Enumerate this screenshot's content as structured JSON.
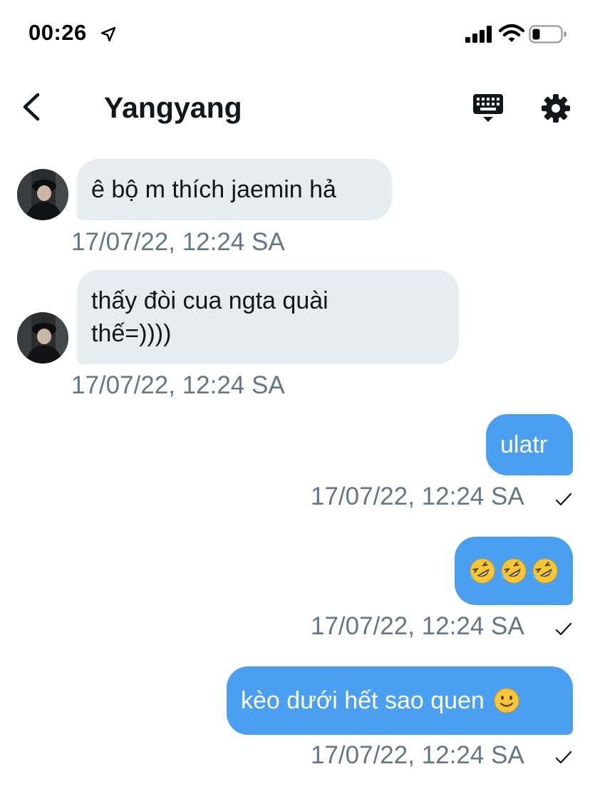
{
  "status_bar": {
    "time": "00:26"
  },
  "header": {
    "title": "Yangyang"
  },
  "messages": [
    {
      "direction": "in",
      "text": "ê bộ m thích jaemin hả",
      "timestamp": "17/07/22, 12:24 SA"
    },
    {
      "direction": "in",
      "text_line1": "thấy đòi cua ngta quài",
      "text_line2": "thế=))))",
      "timestamp": "17/07/22, 12:24 SA"
    },
    {
      "direction": "out",
      "text": "ulatr",
      "timestamp": "17/07/22, 12:24 SA",
      "status": "sent"
    },
    {
      "direction": "out",
      "emojis": [
        "rolling-on-floor-laughing",
        "rolling-on-floor-laughing",
        "rolling-on-floor-laughing"
      ],
      "timestamp": "17/07/22, 12:24 SA",
      "status": "sent"
    },
    {
      "direction": "out",
      "text": "kèo dưới hết sao quen",
      "trailing_emoji": "slightly-smiling-face",
      "timestamp": "17/07/22, 12:24 SA",
      "status": "sent"
    }
  ],
  "icons": {
    "back": "chevron-left-icon",
    "keyboard": "keyboard-icon",
    "settings": "gear-icon",
    "location": "location-arrow-icon",
    "signal": "cellular-signal-icon",
    "wifi": "wifi-icon",
    "battery": "battery-icon",
    "read": "checkmark-icon"
  },
  "colors": {
    "incoming_bubble": "#e6ecf0",
    "outgoing_bubble": "#4a9ff0",
    "timestamp": "#657786",
    "text": "#14171a"
  }
}
